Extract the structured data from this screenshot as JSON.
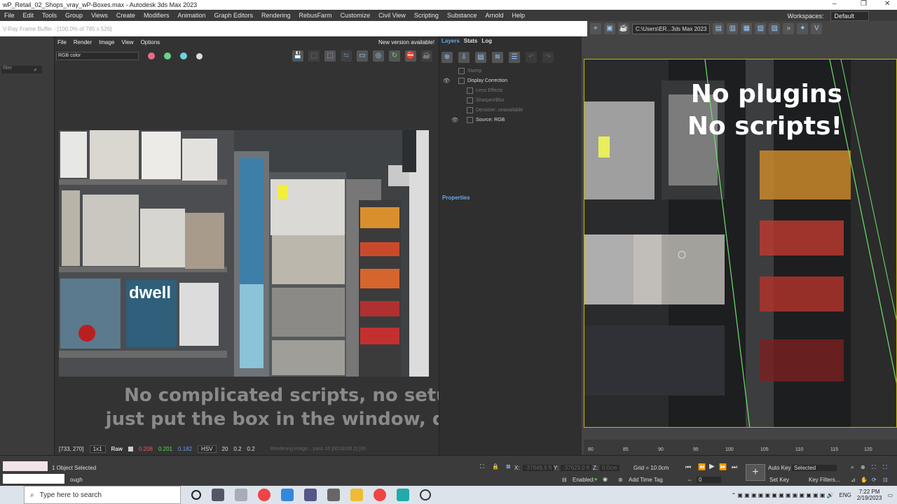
{
  "title_bar": {
    "title": "wP_Retail_02_Shops_vray_wP-Boxes.max - Autodesk 3ds Max 2023",
    "minimize": "–",
    "maximize": "❐",
    "close": "✕"
  },
  "menu": {
    "items": [
      "File",
      "Edit",
      "Tools",
      "Group",
      "Views",
      "Create",
      "Modifiers",
      "Animation",
      "Graph Editors",
      "Rendering",
      "RebusFarm",
      "Customize",
      "Civil View",
      "Scripting",
      "Substance",
      "Arnold",
      "Help"
    ],
    "workspaces_label": "Workspaces:",
    "workspaces_value": "Default"
  },
  "toolbar": {
    "project_path": "C:\\Users\\ER...3ds Max 2023"
  },
  "vfb": {
    "title": "V-Ray Frame Buffer - [100.0% of 785 x 526]",
    "menu": [
      "File",
      "Render",
      "Image",
      "View",
      "Options"
    ],
    "new_version": "New version available!",
    "channel": "RGB color",
    "coords": "[733, 270]",
    "zoom": "1x1",
    "raw_label": "Raw",
    "r": "0.208",
    "g": "0.201",
    "b": "0.182",
    "color_mode": "HSV",
    "v1": "20",
    "v2": "0.2",
    "v3": "0.2",
    "progress": "Rendering image... pass 10 [00:00:06.2] [00",
    "subtitle_line1": "No complicated scripts, no setups",
    "subtitle_line2": "just put the box in the window, done!"
  },
  "left_panel": {
    "filter_placeholder": "filter"
  },
  "layers": {
    "tabs": [
      "Layers",
      "Stats",
      "Log"
    ],
    "items": [
      {
        "label": "Stamp",
        "eye": ""
      },
      {
        "label": "Display Correction",
        "eye": "👁"
      },
      {
        "label": "Lens Effects",
        "eye": ""
      },
      {
        "label": "Sharpen/Blur",
        "eye": ""
      },
      {
        "label": "Denoiser: unavailable",
        "eye": ""
      },
      {
        "label": "Source: RGB",
        "eye": "👁"
      }
    ],
    "properties_label": "Properties"
  },
  "viewport": {
    "caption_line1": "No plugins",
    "caption_line2": "No scripts!"
  },
  "timeline": {
    "ticks": [
      "80",
      "85",
      "90",
      "95",
      "100",
      "105",
      "110",
      "115",
      "120"
    ]
  },
  "status": {
    "selection": "1 Object Selected",
    "prompt": "ough",
    "x_label": "X:",
    "x_value": "-37949.9 ft",
    "y_label": "Y:",
    "y_value": "-37623.0 ft",
    "z_label": "Z:",
    "z_value": "0.0cm",
    "grid": "Grid = 10.0cm",
    "enabled": "Enabled:",
    "add_time_tag": "Add Time Tag",
    "frame": "0",
    "auto_key": "Auto Key",
    "selected": "Selected",
    "set_key": "Set Key",
    "key_filters": "Key Filters..."
  },
  "taskbar": {
    "search_placeholder": "Type here to search",
    "lang": "ENG",
    "time": "7:22 PM",
    "date": "2/19/2023"
  }
}
